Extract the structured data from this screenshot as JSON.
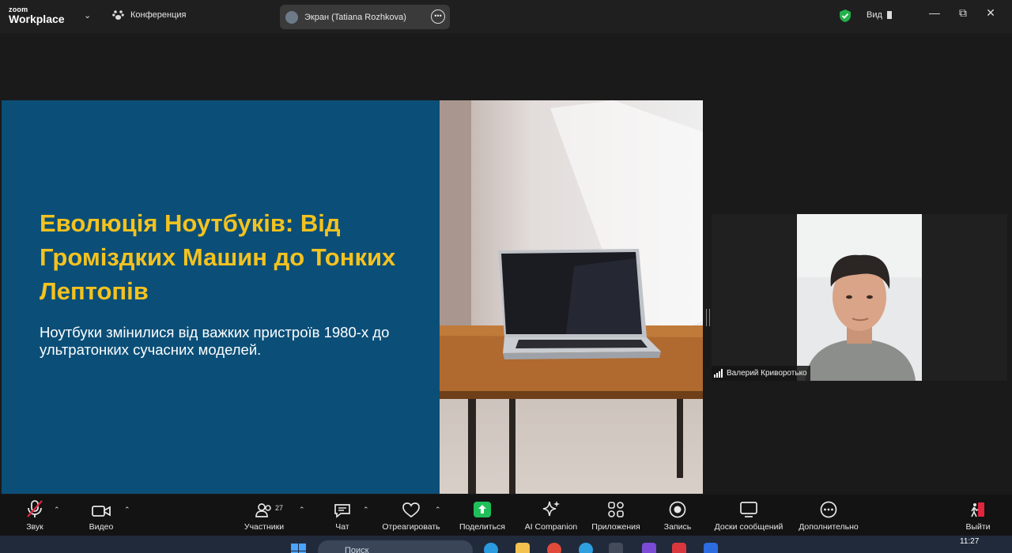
{
  "app": {
    "brand_top": "zoom",
    "brand_bottom": "Workplace"
  },
  "titlebar": {
    "meeting_label": "Конференция",
    "share_label": "Экран (Tatiana Rozhkova)",
    "view_label": "Вид",
    "security_color": "#23b04b"
  },
  "slide": {
    "title": "Еволюція Ноутбуків: Від Громіздких Машин до Тонких Лептопів",
    "subtitle": "Ноутбуки змінилися від важких пристроїв 1980-х до ультратонких сучасних моделей.",
    "background": "#0b4f78",
    "title_color": "#f4c21f"
  },
  "participant": {
    "name": "Валерий Криворотько"
  },
  "toolbar": {
    "audio": "Звук",
    "video": "Видео",
    "participants": "Участники",
    "participants_count": "27",
    "chat": "Чат",
    "react": "Отреагировать",
    "share": "Поделиться",
    "ai": "AI Companion",
    "apps": "Приложения",
    "record": "Запись",
    "whiteboards": "Доски сообщений",
    "more": "Дополнительно",
    "leave": "Выйти",
    "share_color": "#1fbf5a",
    "leave_color": "#e0263d"
  },
  "taskbar": {
    "search_placeholder": "Поиск",
    "time": "11:27"
  }
}
